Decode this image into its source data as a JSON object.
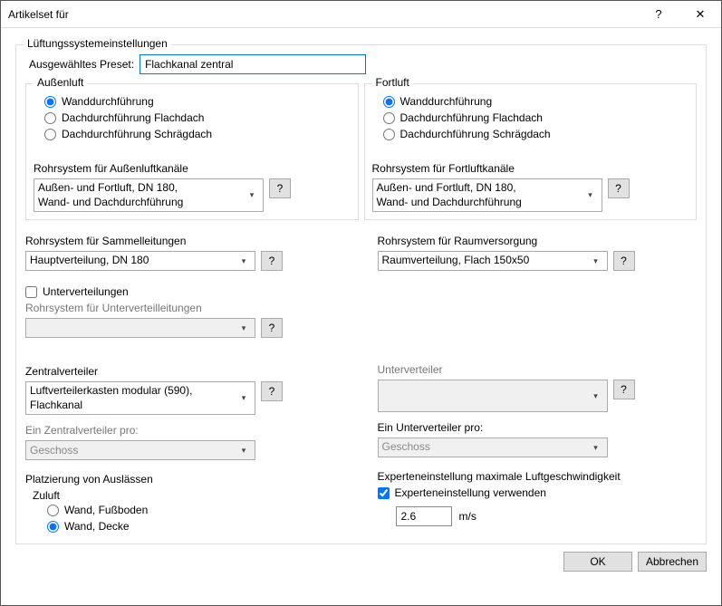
{
  "window": {
    "title": "Artikelset für"
  },
  "group": {
    "title": "Lüftungssystemeinstellungen",
    "preset_label": "Ausgewähltes Preset:",
    "preset_value": "Flachkanal zentral"
  },
  "aussenluft": {
    "title": "Außenluft",
    "opt1": "Wanddurchführung",
    "opt2": "Dachdurchführung Flachdach",
    "opt3": "Dachdurchführung Schrägdach",
    "pipe_label": "Rohrsystem für Außenluftkanäle",
    "pipe_value": "Außen- und Fortluft, DN 180,\nWand- und Dachdurchführung"
  },
  "fortluft": {
    "title": "Fortluft",
    "opt1": "Wanddurchführung",
    "opt2": "Dachdurchführung Flachdach",
    "opt3": "Dachdurchführung Schrägdach",
    "pipe_label": "Rohrsystem für Fortluftkanäle",
    "pipe_value": "Außen- und Fortluft, DN 180,\nWand- und Dachdurchführung"
  },
  "sammel": {
    "label": "Rohrsystem für Sammelleitungen",
    "value": "Hauptverteilung, DN 180"
  },
  "raum": {
    "label": "Rohrsystem für Raumversorgung",
    "value": "Raumverteilung, Flach 150x50"
  },
  "unterv": {
    "checkbox": "Unterverteilungen",
    "pipe_label": "Rohrsystem für Unterverteilleitungen"
  },
  "zentral": {
    "label": "Zentralverteiler",
    "value": "Luftverteilerkasten modular (590), Flachkanal",
    "per_label": "Ein Zentralverteiler pro:",
    "per_value": "Geschoss"
  },
  "untervert": {
    "label": "Unterverteiler",
    "per_label": "Ein Unterverteiler pro:",
    "per_value": "Geschoss"
  },
  "platz": {
    "title": "Platzierung von Auslässen",
    "zuluft": "Zuluft",
    "opt1": "Wand, Fußboden",
    "opt2": "Wand, Decke"
  },
  "expert": {
    "title": "Experteneinstellung maximale Luftgeschwindigkeit",
    "checkbox": "Experteneinstellung verwenden",
    "value": "2.6",
    "unit": "m/s"
  },
  "buttons": {
    "ok": "OK",
    "cancel": "Abbrechen",
    "help": "?"
  }
}
